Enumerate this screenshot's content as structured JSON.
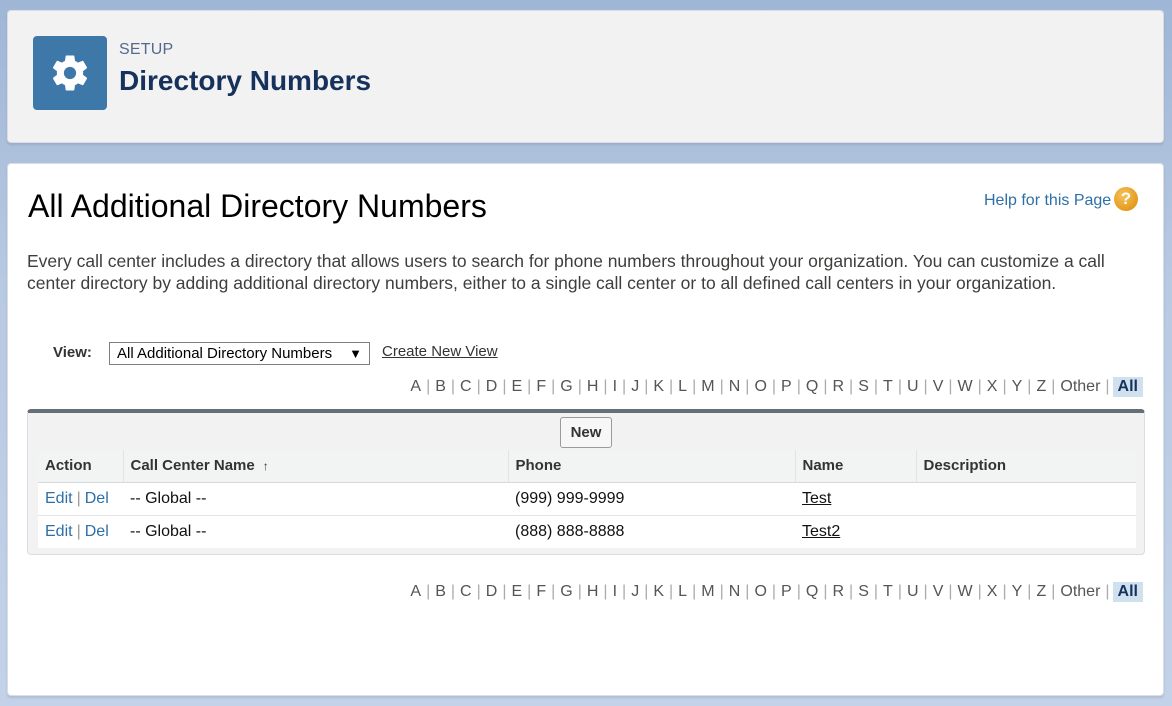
{
  "header": {
    "eyebrow": "SETUP",
    "title": "Directory Numbers",
    "icon": "gear-icon",
    "icon_bg": "#3e78a8"
  },
  "page": {
    "title": "All Additional Directory Numbers",
    "help_link": "Help for this Page",
    "help_icon": "?",
    "description": "Every call center includes a directory that allows users to search for phone numbers throughout your organization. You can customize a call center directory by adding additional directory numbers, either to a single call center or to all defined call centers in your organization."
  },
  "view": {
    "label": "View:",
    "selected": "All Additional Directory Numbers",
    "create_new_view": "Create New View"
  },
  "alphabet": [
    "A",
    "B",
    "C",
    "D",
    "E",
    "F",
    "G",
    "H",
    "I",
    "J",
    "K",
    "L",
    "M",
    "N",
    "O",
    "P",
    "Q",
    "R",
    "S",
    "T",
    "U",
    "V",
    "W",
    "X",
    "Y",
    "Z",
    "Other",
    "All"
  ],
  "list": {
    "new_button": "New",
    "columns": [
      "Action",
      "Call Center Name",
      "Phone",
      "Name",
      "Description"
    ],
    "sort_indicator": "↑",
    "edit_label": "Edit",
    "del_label": "Del",
    "rows": [
      {
        "call_center": "-- Global --",
        "phone": "(999) 999-9999",
        "name": "Test",
        "description": ""
      },
      {
        "call_center": "-- Global --",
        "phone": "(888) 888-8888",
        "name": "Test2",
        "description": ""
      }
    ]
  }
}
